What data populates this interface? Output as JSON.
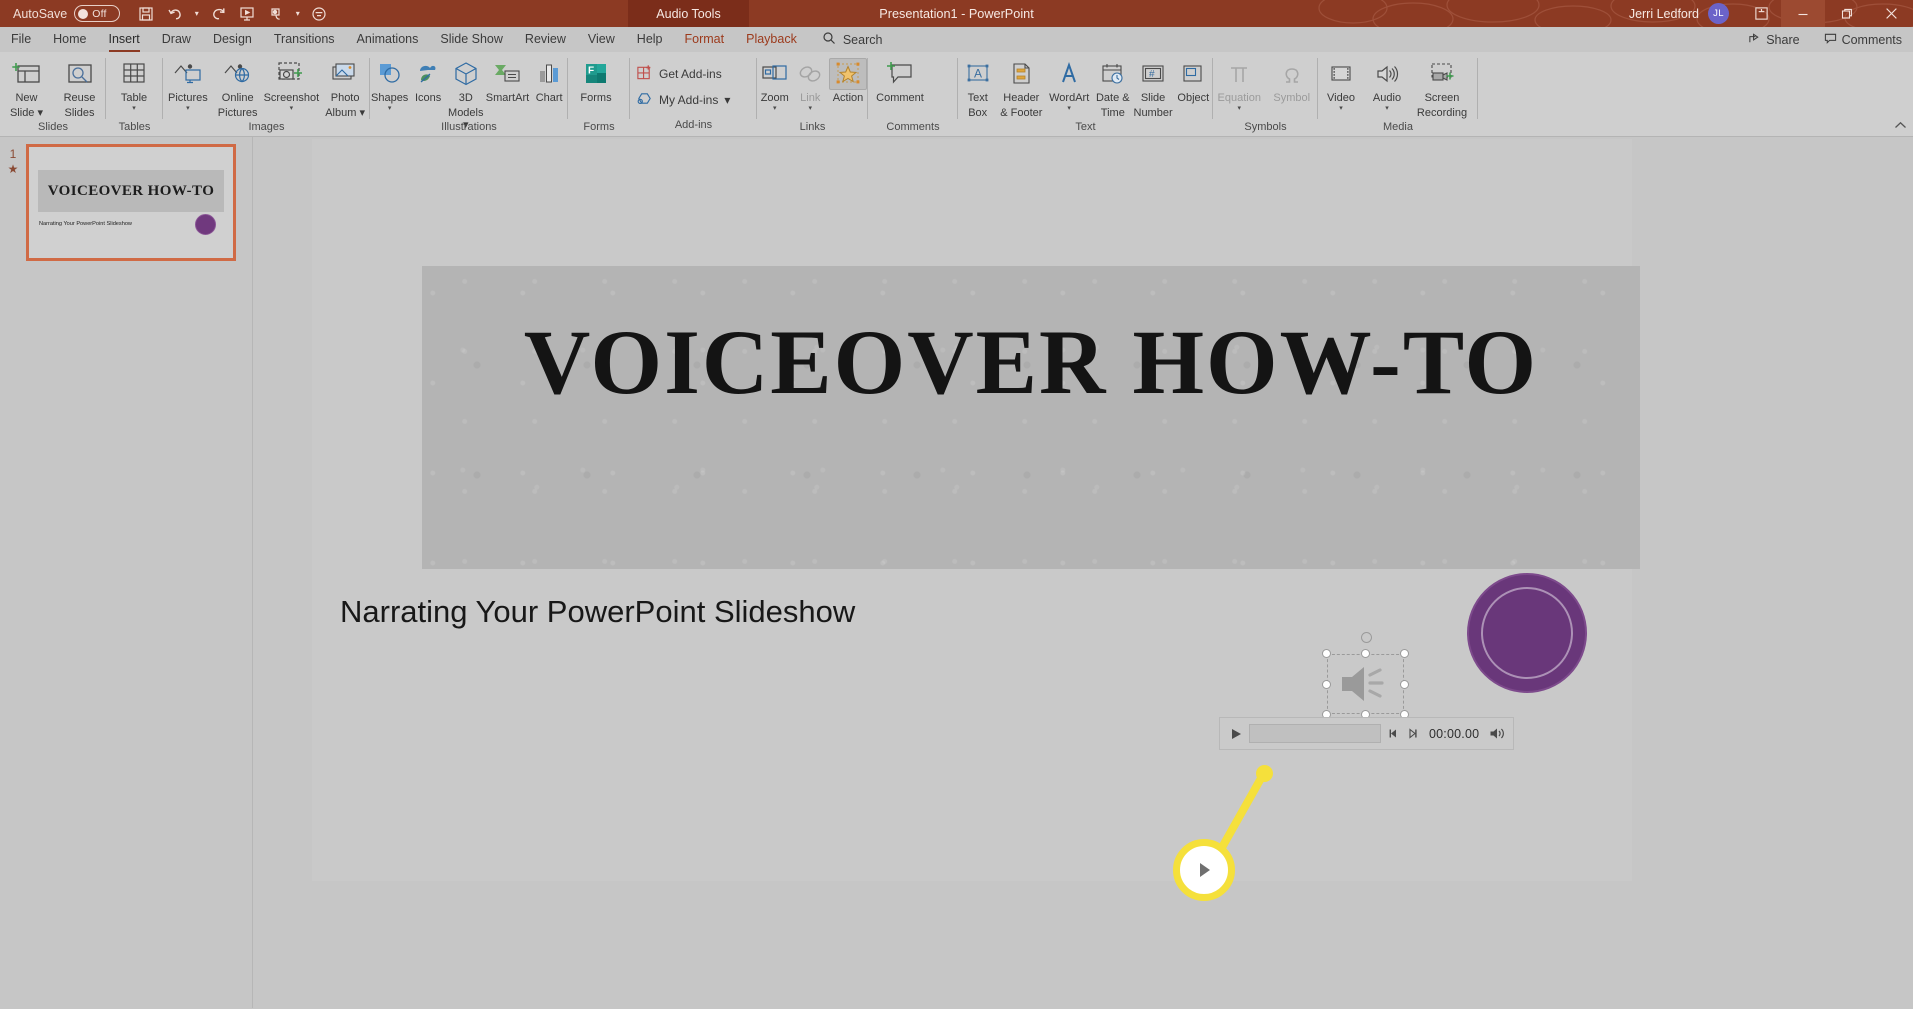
{
  "titlebar": {
    "autosave_label": "AutoSave",
    "autosave_state": "Off",
    "document_title": "Presentation1  -  PowerPoint",
    "contextual_tab": "Audio Tools",
    "user_name": "Jerri Ledford",
    "avatar_initials": "JL",
    "quick_access": [
      {
        "name": "save-icon"
      },
      {
        "name": "undo-icon"
      },
      {
        "name": "redo-icon"
      },
      {
        "name": "start-from-beginning-icon"
      },
      {
        "name": "touch-mouse-mode-icon"
      },
      {
        "name": "customize-quick-access-toolbar-icon"
      }
    ],
    "window_controls": [
      "ribbon-display-options",
      "minimize",
      "restore",
      "close"
    ],
    "accent_color": "#8c3a23"
  },
  "tabs": [
    {
      "label": "File",
      "state": "normal"
    },
    {
      "label": "Home",
      "state": "normal"
    },
    {
      "label": "Insert",
      "state": "active"
    },
    {
      "label": "Draw",
      "state": "normal"
    },
    {
      "label": "Design",
      "state": "normal"
    },
    {
      "label": "Transitions",
      "state": "normal"
    },
    {
      "label": "Animations",
      "state": "normal"
    },
    {
      "label": "Slide Show",
      "state": "normal"
    },
    {
      "label": "Review",
      "state": "normal"
    },
    {
      "label": "View",
      "state": "normal"
    },
    {
      "label": "Help",
      "state": "normal"
    },
    {
      "label": "Format",
      "state": "contextual"
    },
    {
      "label": "Playback",
      "state": "contextual"
    }
  ],
  "search": {
    "label": "Search",
    "icon": "search-icon"
  },
  "tabbar_right": [
    {
      "label": "Share",
      "icon": "share-icon"
    },
    {
      "label": "Comments",
      "icon": "comments-icon"
    }
  ],
  "ribbon": {
    "groups": [
      {
        "label": "Slides",
        "items": [
          {
            "label": "New\nSlide",
            "icon": "new-slide-icon",
            "caret": true,
            "state": "normal"
          },
          {
            "label": "Reuse\nSlides",
            "icon": "reuse-slides-icon",
            "caret": false,
            "state": "normal"
          }
        ]
      },
      {
        "label": "Tables",
        "items": [
          {
            "label": "Table",
            "icon": "table-icon",
            "caret": true,
            "state": "normal"
          }
        ]
      },
      {
        "label": "Images",
        "items": [
          {
            "label": "Pictures",
            "icon": "pictures-icon",
            "caret": true,
            "state": "normal"
          },
          {
            "label": "Online\nPictures",
            "icon": "online-pictures-icon",
            "caret": false,
            "state": "normal"
          },
          {
            "label": "Screenshot",
            "icon": "screenshot-icon",
            "caret": true,
            "state": "normal"
          },
          {
            "label": "Photo\nAlbum",
            "icon": "photo-album-icon",
            "caret": true,
            "state": "normal"
          }
        ]
      },
      {
        "label": "Illustrations",
        "items": [
          {
            "label": "Shapes",
            "icon": "shapes-icon",
            "caret": true,
            "state": "normal"
          },
          {
            "label": "Icons",
            "icon": "icons-icon",
            "caret": false,
            "state": "normal"
          },
          {
            "label": "3D\nModels",
            "icon": "3d-models-icon",
            "caret": true,
            "state": "normal"
          },
          {
            "label": "SmartArt",
            "icon": "smartart-icon",
            "caret": false,
            "state": "normal"
          },
          {
            "label": "Chart",
            "icon": "chart-icon",
            "caret": false,
            "state": "normal"
          }
        ]
      },
      {
        "label": "Forms",
        "items": [
          {
            "label": "Forms",
            "icon": "forms-icon",
            "caret": false,
            "state": "normal"
          }
        ]
      },
      {
        "label": "Add-ins",
        "small_items": [
          {
            "label": "Get Add-ins",
            "icon": "get-addins-icon",
            "caret": false
          },
          {
            "label": "My Add-ins",
            "icon": "my-addins-icon",
            "caret": true
          }
        ]
      },
      {
        "label": "Links",
        "items": [
          {
            "label": "Zoom",
            "icon": "zoom-icon",
            "caret": true,
            "state": "normal"
          },
          {
            "label": "Link",
            "icon": "link-icon",
            "caret": true,
            "state": "disabled"
          },
          {
            "label": "Action",
            "icon": "action-icon",
            "caret": false,
            "state": "normal"
          }
        ]
      },
      {
        "label": "Comments",
        "items": [
          {
            "label": "Comment",
            "icon": "comment-icon",
            "caret": false,
            "state": "normal"
          }
        ]
      },
      {
        "label": "Text",
        "items": [
          {
            "label": "Text\nBox",
            "icon": "text-box-icon",
            "caret": false,
            "state": "normal"
          },
          {
            "label": "Header\n& Footer",
            "icon": "header-footer-icon",
            "caret": false,
            "state": "normal"
          },
          {
            "label": "WordArt",
            "icon": "wordart-icon",
            "caret": true,
            "state": "normal"
          },
          {
            "label": "Date &\nTime",
            "icon": "date-time-icon",
            "caret": false,
            "state": "normal"
          },
          {
            "label": "Slide\nNumber",
            "icon": "slide-number-icon",
            "caret": false,
            "state": "normal"
          },
          {
            "label": "Object",
            "icon": "object-icon",
            "caret": false,
            "state": "normal"
          }
        ]
      },
      {
        "label": "Symbols",
        "items": [
          {
            "label": "Equation",
            "icon": "equation-icon",
            "caret": true,
            "state": "disabled"
          },
          {
            "label": "Symbol",
            "icon": "symbol-icon",
            "caret": false,
            "state": "disabled"
          }
        ]
      },
      {
        "label": "Media",
        "items": [
          {
            "label": "Video",
            "icon": "video-icon",
            "caret": true,
            "state": "normal"
          },
          {
            "label": "Audio",
            "icon": "audio-icon",
            "caret": true,
            "state": "normal"
          },
          {
            "label": "Screen\nRecording",
            "icon": "screen-recording-icon",
            "caret": false,
            "state": "normal"
          }
        ]
      }
    ],
    "collapse_icon": "collapse-ribbon-icon"
  },
  "thumbnails": {
    "slides": [
      {
        "number": "1",
        "animation_marker": "★",
        "title": "VOICEOVER HOW-TO",
        "subtitle": "Narrating Your PowerPoint Slideshow",
        "selected": true
      }
    ],
    "selection_color": "#d06a45"
  },
  "slide": {
    "title": "VOICEOVER  HOW-TO",
    "subtitle": "Narrating Your PowerPoint Slideshow",
    "badge_color": "#69377a"
  },
  "audio_object": {
    "name": "speaker-icon",
    "selected": true,
    "handles": 8,
    "rotation_handle": true
  },
  "audio_player": {
    "play_label": "play-icon",
    "back_label": "step-back-icon",
    "forward_label": "step-forward-icon",
    "time": "00:00.00",
    "volume_label": "volume-icon",
    "progress_percent": 0
  },
  "callout": {
    "icon": "play-icon",
    "highlight_color": "#f5e03b"
  }
}
